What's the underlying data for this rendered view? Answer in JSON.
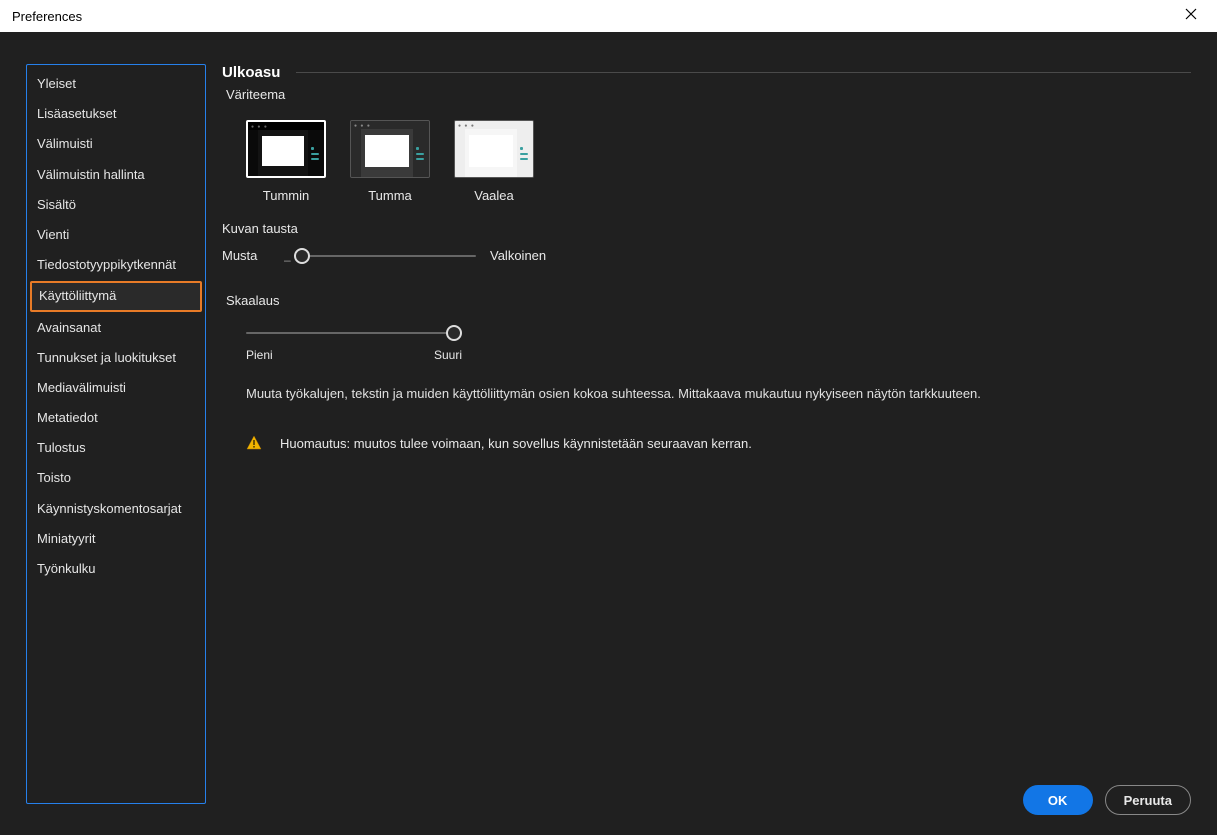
{
  "window": {
    "title": "Preferences"
  },
  "sidebar": {
    "items": [
      "Yleiset",
      "Lisäasetukset",
      "Välimuisti",
      "Välimuistin hallinta",
      "Sisältö",
      "Vienti",
      "Tiedostotyyppikytkennät",
      "Käyttöliittymä",
      "Avainsanat",
      "Tunnukset ja luokitukset",
      "Mediavälimuisti",
      "Metatiedot",
      "Tulostus",
      "Toisto",
      "Käynnistyskomentosarjat",
      "Miniatyyrit",
      "Työnkulku"
    ],
    "selected_index": 7
  },
  "appearance": {
    "section_title": "Ulkoasu",
    "color_theme_label": "Väriteema",
    "themes": [
      {
        "name": "Tummin",
        "variant": "darkest",
        "selected": true
      },
      {
        "name": "Tumma",
        "variant": "dark",
        "selected": false
      },
      {
        "name": "Vaalea",
        "variant": "light",
        "selected": false
      }
    ],
    "image_bg": {
      "label": "Kuvan tausta",
      "left": "Musta",
      "right": "Valkoinen",
      "value": 0.0
    },
    "scaling": {
      "label": "Skaalaus",
      "small": "Pieni",
      "large": "Suuri",
      "value": 1.0,
      "description": "Muuta työkalujen, tekstin ja muiden käyttöliittymän osien kokoa suhteessa. Mittakaava mukautuu nykyiseen näytön tarkkuuteen.",
      "warning": "Huomautus: muutos tulee voimaan, kun sovellus käynnistetään seuraavan kerran."
    }
  },
  "footer": {
    "ok": "OK",
    "cancel": "Peruuta"
  }
}
